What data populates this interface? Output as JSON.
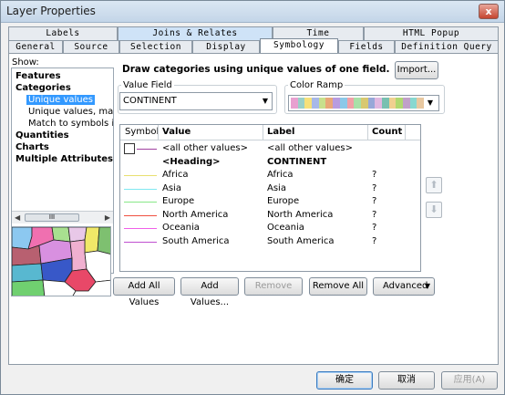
{
  "window": {
    "title": "Layer Properties",
    "close_glyph": "x"
  },
  "tabs_top": [
    "Labels",
    "Joins & Relates",
    "Time",
    "HTML Popup"
  ],
  "tabs_bottom": [
    "General",
    "Source",
    "Selection",
    "Display",
    "Symbology",
    "Fields",
    "Definition Query"
  ],
  "show": {
    "label": "Show:",
    "tree": [
      {
        "label": "Features",
        "level": 0
      },
      {
        "label": "Categories",
        "level": 0
      },
      {
        "label": "Unique values",
        "level": 1,
        "selected": true
      },
      {
        "label": "Unique values, many",
        "level": 1
      },
      {
        "label": "Match to symbols in a",
        "level": 1
      },
      {
        "label": "Quantities",
        "level": 0
      },
      {
        "label": "Charts",
        "level": 0
      },
      {
        "label": "Multiple Attributes",
        "level": 0
      }
    ],
    "scroll_thumb": "III"
  },
  "description": "Draw categories using unique values of one field.",
  "import_button": "Import...",
  "value_field": {
    "label": "Value Field",
    "value": "CONTINENT"
  },
  "color_ramp": {
    "label": "Color Ramp",
    "colors": [
      "#e8a0d0",
      "#9ad0c8",
      "#f6e07a",
      "#a8b8e8",
      "#c8e08c",
      "#e8a878",
      "#b89ce0",
      "#8cc8e8",
      "#f0a0a8",
      "#a8e0a8",
      "#d8c870",
      "#98a8d8",
      "#e0b8e0",
      "#78c0b0",
      "#f0d090",
      "#b0d870",
      "#c0a0c8",
      "#88d8d0",
      "#e8c8a0"
    ]
  },
  "grid": {
    "headers": [
      "Symbol",
      "Value",
      "Label",
      "Count"
    ],
    "rows": [
      {
        "value": "<all other values>",
        "label": "<all other values>",
        "count": "",
        "symbol_color": "#a040a0",
        "kind": "other"
      },
      {
        "value": "<Heading>",
        "label": "CONTINENT",
        "count": "",
        "symbol_color": "",
        "kind": "heading"
      },
      {
        "value": "Africa",
        "label": "Africa",
        "count": "?",
        "symbol_color": "#e8e070"
      },
      {
        "value": "Asia",
        "label": "Asia",
        "count": "?",
        "symbol_color": "#80e8f0"
      },
      {
        "value": "Europe",
        "label": "Europe",
        "count": "?",
        "symbol_color": "#88e888"
      },
      {
        "value": "North America",
        "label": "North America",
        "count": "?",
        "symbol_color": "#f05040"
      },
      {
        "value": "Oceania",
        "label": "Oceania",
        "count": "?",
        "symbol_color": "#f060e8"
      },
      {
        "value": "South America",
        "label": "South America",
        "count": "?",
        "symbol_color": "#c050d0"
      }
    ]
  },
  "updown": {
    "up": "⬆",
    "down": "⬇"
  },
  "bottom_buttons": {
    "add_all": "Add All Values",
    "add_values": "Add Values...",
    "remove": "Remove",
    "remove_all": "Remove All",
    "advanced": "Advanced"
  },
  "dialog_buttons": {
    "ok": "确定",
    "cancel": "取消",
    "apply": "应用(A)"
  }
}
